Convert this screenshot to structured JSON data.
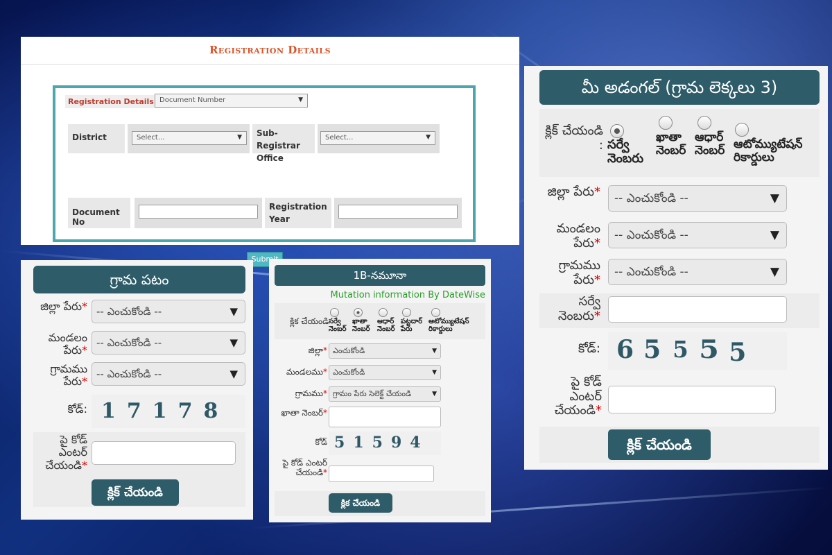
{
  "registration": {
    "title": "Registration Details",
    "details_of_label": "Registration Details of:",
    "details_of_value": "Document Number",
    "district_label": "District",
    "district_value": "Select...",
    "sro_label": "Sub-Registrar Office",
    "sro_value": "Select...",
    "docno_label": "Document No",
    "docno_value": "",
    "regyear_label": "Registration Year",
    "regyear_value": "",
    "submit_label": "Submit"
  },
  "adangal": {
    "title": "మీ అడంగల్ (గ్రామ లెక్కలు 3)",
    "click_label": "క్లిక్ చేయండి :",
    "radios": [
      {
        "label": "సర్వే నెంబరు",
        "checked": true
      },
      {
        "label": "ఖాతా నెంబర్",
        "checked": false
      },
      {
        "label": "ఆధార్ నెంబర్",
        "checked": false
      },
      {
        "label": "ఆటోమ్యుటేషన్ రికార్డులు",
        "checked": false
      }
    ],
    "district_label": "జిల్లా పేరు",
    "district_value": "-- ఎంచుకోండి --",
    "mandal_label": "మండలం పేరు",
    "mandal_value": "-- ఎంచుకోండి --",
    "village_label": "గ్రామము పేరు",
    "village_value": "-- ఎంచుకోండి --",
    "survey_label": "సర్వే నెంబరు",
    "survey_value": "",
    "code_label": "కోడ్:",
    "captcha": [
      "6",
      "5",
      "5",
      "5",
      "5"
    ],
    "enter_code_label": "పై కోడ్ ఎంటర్ చేయండి",
    "enter_code_value": "",
    "button_label": "క్లిక్ చేయండి",
    "required_mark": "*"
  },
  "grama_patam": {
    "title": "గ్రామ పటం",
    "district_label": "జిల్లా పేరు",
    "district_value": "-- ఎంచుకోండి --",
    "mandal_label": "మండలం పేరు",
    "mandal_value": "-- ఎంచుకోండి --",
    "village_label": "గ్రామము పేరు",
    "village_value": "-- ఎంచుకోండి --",
    "code_label": "కోడ్:",
    "captcha": [
      "1",
      "7",
      "1",
      "7",
      "8"
    ],
    "enter_code_label": "పై కోడ్ ఎంటర్ చేయండి",
    "enter_code_value": "",
    "button_label": "క్లిక్ చేయండి",
    "required_mark": "*"
  },
  "one_b": {
    "title": "1B-నమూనా",
    "mutation_link": "Mutation information By DateWise",
    "click_label": "క్లిక చేయండి",
    "radios": [
      {
        "label": "సర్వే నెంబర్",
        "checked": false
      },
      {
        "label": "ఖాతా నెంబర్",
        "checked": true
      },
      {
        "label": "ఆధార్ నెంబర్",
        "checked": false
      },
      {
        "label": "పట్టదార్ పేరు",
        "checked": false
      },
      {
        "label": "ఆటోమ్యుటేషన్ రికార్డులు",
        "checked": false
      }
    ],
    "district_label": "జిల్లా",
    "district_value": "ఎంచుకోండి",
    "mandal_label": "మండలము",
    "mandal_value": "ఎంచుకోండి",
    "village_label": "గ్రామము",
    "village_value": "గ్రామం పేరు సెలెక్ట్ చేయండి",
    "khata_label": "ఖాతా నెంబర్",
    "khata_value": "",
    "code_label": "కోడ్",
    "captcha": [
      "5",
      "1",
      "5",
      "9",
      "4"
    ],
    "enter_code_label": "పై కోడ్ ఎంటర్ చేయండి",
    "enter_code_value": "",
    "button_label": "క్లిక చేయండి",
    "required_mark": "*"
  },
  "colors": {
    "header_teal": "#2e5c69",
    "reg_border": "#4aa7ad",
    "reg_title": "#d9552a",
    "required": "#dd0000",
    "mutation_link": "#2a9d2a"
  }
}
